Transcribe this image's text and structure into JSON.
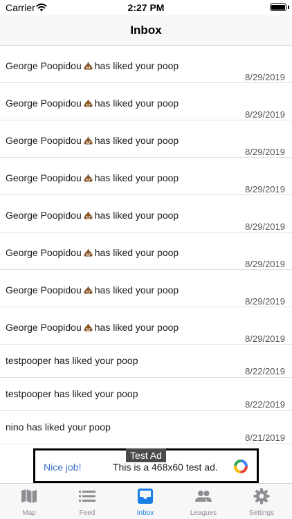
{
  "status_bar": {
    "carrier": "Carrier",
    "time": "2:27 PM"
  },
  "nav": {
    "title": "Inbox"
  },
  "notifications": [
    {
      "user": "George Poopidou",
      "icon": "poop-emoji-icon",
      "message": "has liked your poop",
      "date": "8/29/2019"
    },
    {
      "user": "George Poopidou",
      "icon": "poop-emoji-icon",
      "message": "has liked your poop",
      "date": "8/29/2019"
    },
    {
      "user": "George Poopidou",
      "icon": "poop-emoji-icon",
      "message": "has liked your poop",
      "date": "8/29/2019"
    },
    {
      "user": "George Poopidou",
      "icon": "poop-emoji-icon",
      "message": "has liked your poop",
      "date": "8/29/2019"
    },
    {
      "user": "George Poopidou",
      "icon": "poop-emoji-icon",
      "message": "has liked your poop",
      "date": "8/29/2019"
    },
    {
      "user": "George Poopidou",
      "icon": "poop-emoji-icon",
      "message": "has liked your poop",
      "date": "8/29/2019"
    },
    {
      "user": "George Poopidou",
      "icon": "poop-emoji-icon",
      "message": "has liked your poop",
      "date": "8/29/2019"
    },
    {
      "user": "George Poopidou",
      "icon": "poop-emoji-icon",
      "message": "has liked your poop",
      "date": "8/29/2019"
    },
    {
      "user": "testpooper",
      "message": "has liked your poop",
      "date": "8/22/2019"
    },
    {
      "user": "testpooper",
      "message": "has liked your poop",
      "date": "8/22/2019"
    },
    {
      "user": "nino",
      "message": "has liked your poop",
      "date": "8/21/2019"
    }
  ],
  "ad": {
    "label": "Test Ad",
    "headline": "Nice job!",
    "body": "This is a 468x60 test ad.",
    "icon": "ad-choices-icon"
  },
  "tabs": [
    {
      "label": "Map",
      "icon": "map-icon",
      "active": false
    },
    {
      "label": "Feed",
      "icon": "feed-list-icon",
      "active": false
    },
    {
      "label": "Inbox",
      "icon": "inbox-icon",
      "active": true
    },
    {
      "label": "Leagues",
      "icon": "people-icon",
      "active": false
    },
    {
      "label": "Settings",
      "icon": "gear-icon",
      "active": false
    }
  ],
  "colors": {
    "accent": "#1a7ee6",
    "inactive_tab": "#8e8e93",
    "ad_headline": "#3c74c9",
    "separator": "#e2e2e2"
  }
}
